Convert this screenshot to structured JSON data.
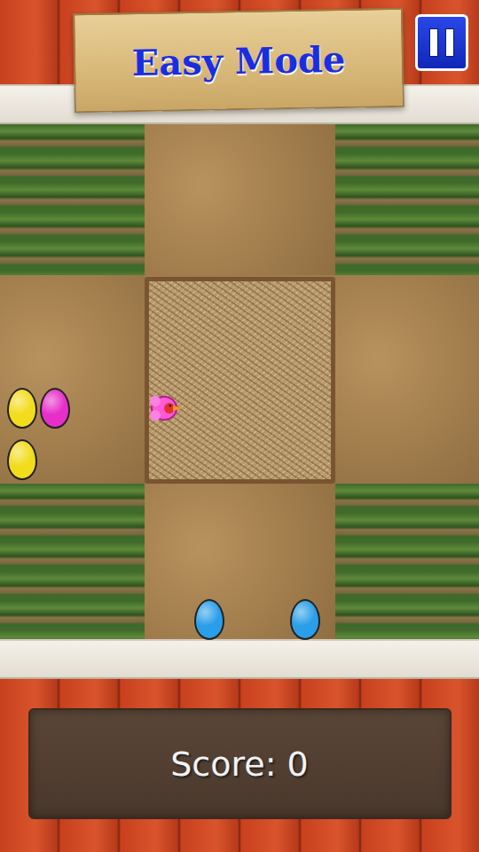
{
  "mode": {
    "title": "Easy Mode"
  },
  "score": {
    "text": "Score: 0"
  },
  "eggs": [
    {
      "color": "#f2dc1c"
    },
    {
      "color": "#e62ec8"
    },
    {
      "color": "#f2dc1c"
    },
    {
      "color": "#2a9ee8"
    },
    {
      "color": "#2a9ee8"
    }
  ]
}
